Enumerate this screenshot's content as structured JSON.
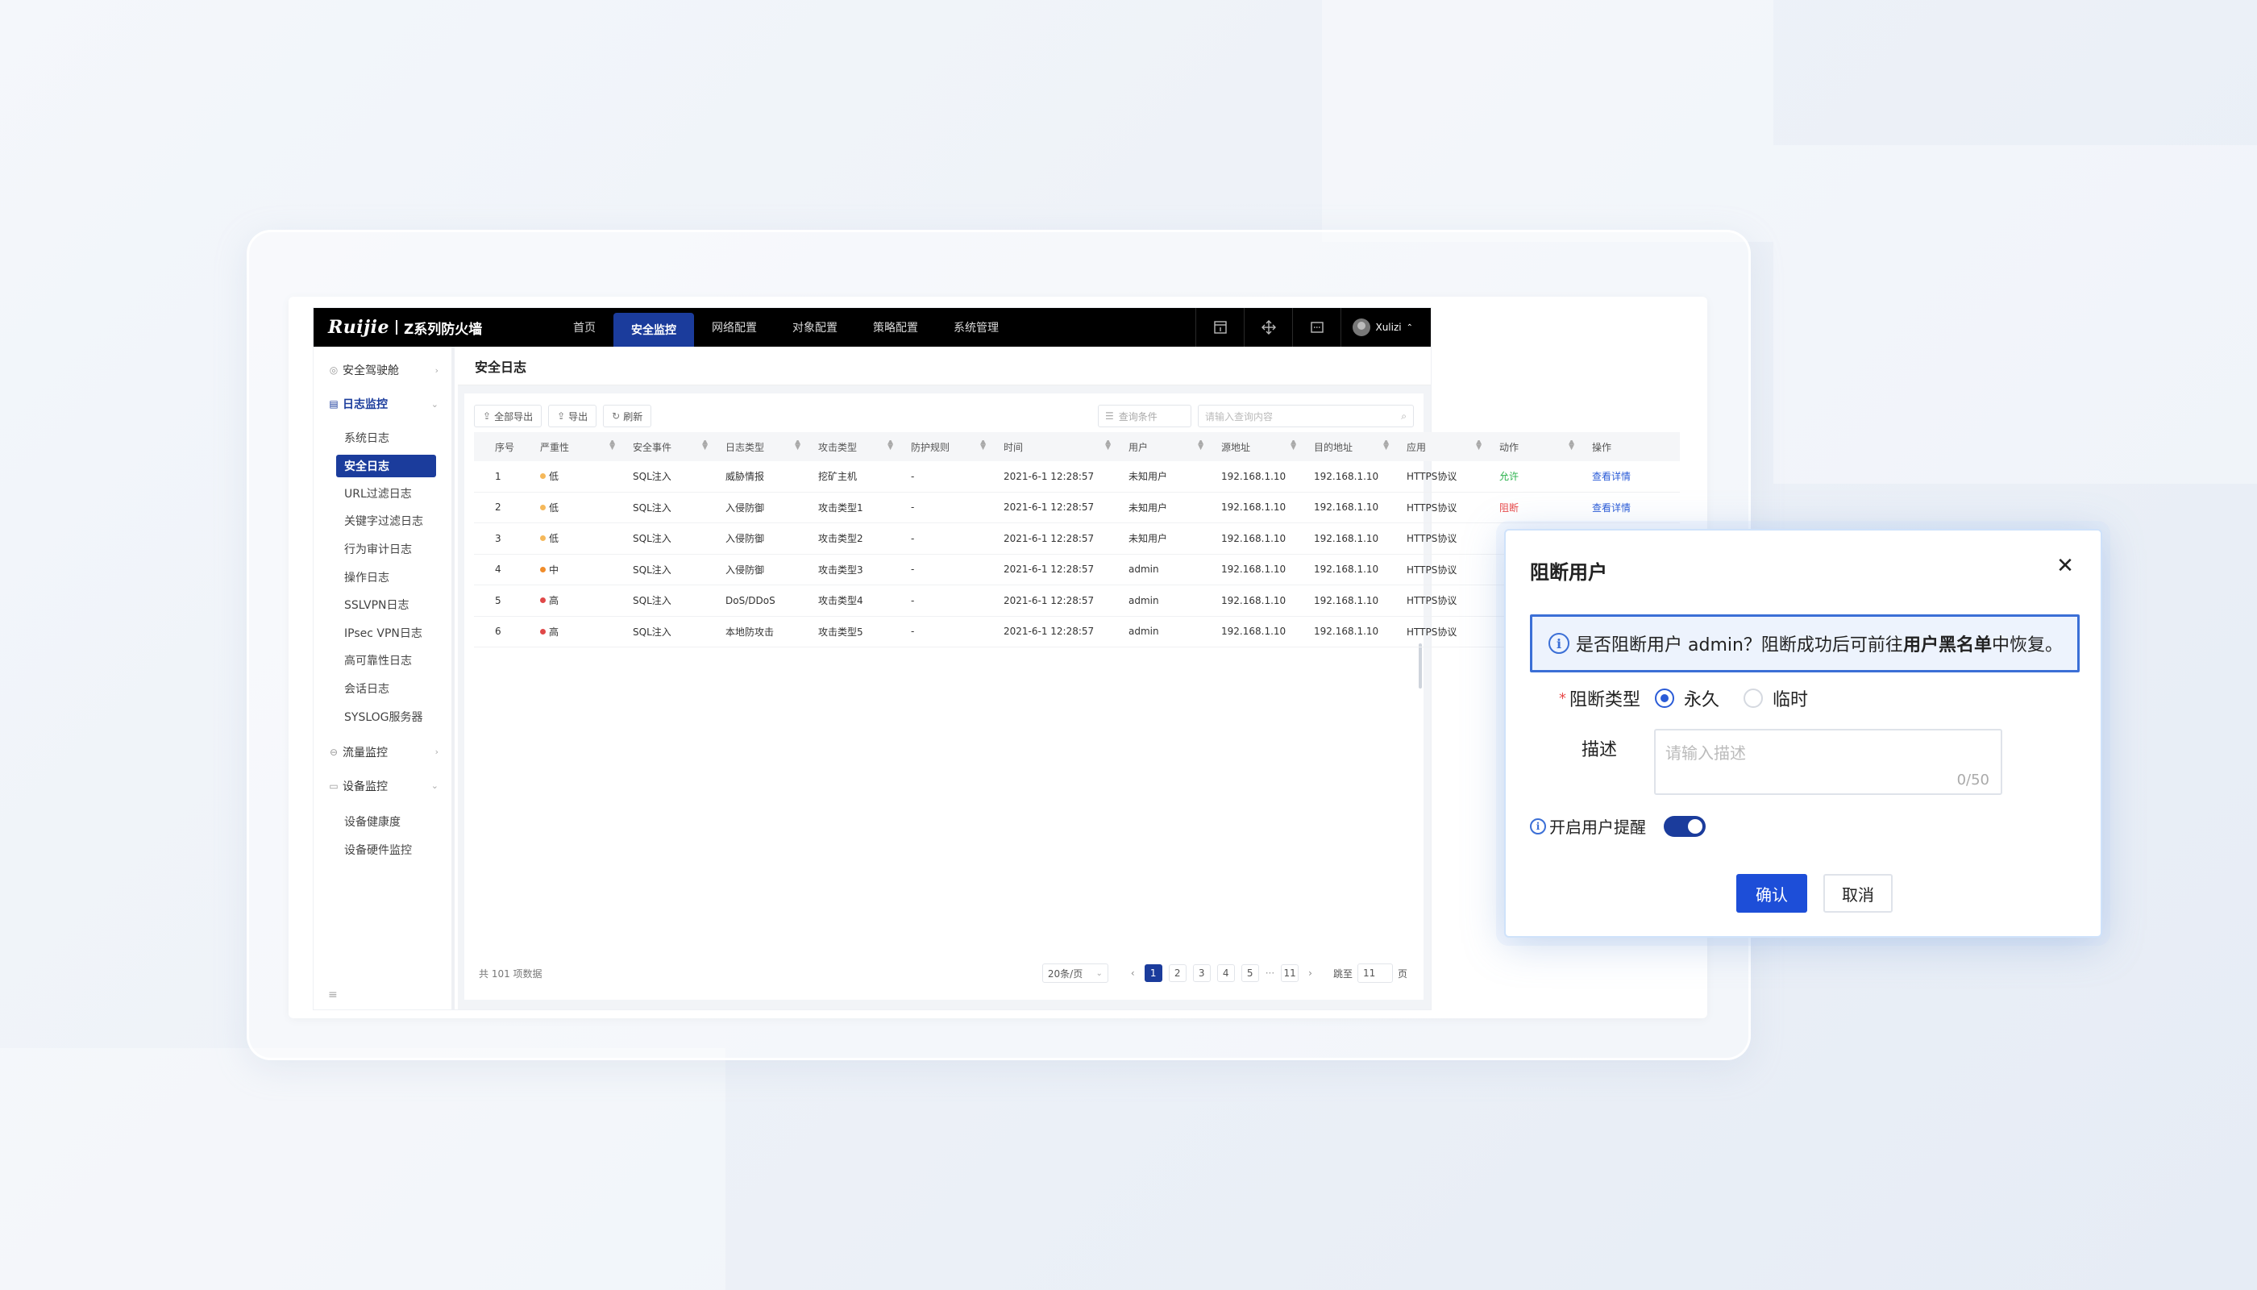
{
  "app": {
    "logo_brand": "Ruijie",
    "logo_product": "Z系列防火墙",
    "nav": [
      {
        "label": "首页"
      },
      {
        "label": "安全监控"
      },
      {
        "label": "网络配置"
      },
      {
        "label": "对象配置"
      },
      {
        "label": "策略配置"
      },
      {
        "label": "系统管理"
      }
    ],
    "nav_active_index": 1,
    "user": "Xulizi"
  },
  "sidebar": {
    "groups": [
      {
        "label": "安全驾驶舱",
        "icon": "dashboard-icon",
        "state": "collapsed"
      },
      {
        "label": "日志监控",
        "icon": "log-icon",
        "state": "expanded"
      },
      {
        "label": "流量监控",
        "icon": "traffic-icon",
        "state": "collapsed"
      },
      {
        "label": "设备监控",
        "icon": "device-icon",
        "state": "expanded"
      }
    ],
    "log_items": [
      "系统日志",
      "安全日志",
      "URL过滤日志",
      "关键字过滤日志",
      "行为审计日志",
      "操作日志",
      "SSLVPN日志",
      "IPsec VPN日志",
      "高可靠性日志",
      "会话日志",
      "SYSLOG服务器"
    ],
    "log_active_index": 1,
    "device_items": [
      "设备健康度",
      "设备硬件监控"
    ]
  },
  "page": {
    "title": "安全日志",
    "toolbar": {
      "export_all": "全部导出",
      "export": "导出",
      "refresh": "刷新",
      "filter_placeholder": "查询条件",
      "search_placeholder": "请输入查询内容"
    }
  },
  "table": {
    "columns": [
      "序号",
      "严重性",
      "安全事件",
      "日志类型",
      "攻击类型",
      "防护规则",
      "时间",
      "用户",
      "源地址",
      "目的地址",
      "应用",
      "动作",
      "操作"
    ],
    "rows": [
      {
        "no": "1",
        "severity": "低",
        "sev_color": "#f5b85a",
        "event": "SQL注入",
        "log_type": "威胁情报",
        "attack": "挖矿主机",
        "rule": "-",
        "time": "2021-6-1 12:28:57",
        "user": "未知用户",
        "src": "192.168.1.10",
        "dst": "192.168.1.10",
        "app": "HTTPS协议",
        "action": "允许",
        "op": "查看详情"
      },
      {
        "no": "2",
        "severity": "低",
        "sev_color": "#f5b85a",
        "event": "SQL注入",
        "log_type": "入侵防御",
        "attack": "攻击类型1",
        "rule": "-",
        "time": "2021-6-1 12:28:57",
        "user": "未知用户",
        "src": "192.168.1.10",
        "dst": "192.168.1.10",
        "app": "HTTPS协议",
        "action": "阻断",
        "op": "查看详情"
      },
      {
        "no": "3",
        "severity": "低",
        "sev_color": "#f5b85a",
        "event": "SQL注入",
        "log_type": "入侵防御",
        "attack": "攻击类型2",
        "rule": "-",
        "time": "2021-6-1 12:28:57",
        "user": "未知用户",
        "src": "192.168.1.10",
        "dst": "192.168.1.10",
        "app": "HTTPS协议",
        "action": "",
        "op": ""
      },
      {
        "no": "4",
        "severity": "中",
        "sev_color": "#f08c2a",
        "event": "SQL注入",
        "log_type": "入侵防御",
        "attack": "攻击类型3",
        "rule": "-",
        "time": "2021-6-1 12:28:57",
        "user": "admin",
        "src": "192.168.1.10",
        "dst": "192.168.1.10",
        "app": "HTTPS协议",
        "action": "",
        "op": ""
      },
      {
        "no": "5",
        "severity": "高",
        "sev_color": "#e04848",
        "event": "SQL注入",
        "log_type": "DoS/DDoS",
        "attack": "攻击类型4",
        "rule": "-",
        "time": "2021-6-1 12:28:57",
        "user": "admin",
        "src": "192.168.1.10",
        "dst": "192.168.1.10",
        "app": "HTTPS协议",
        "action": "",
        "op": ""
      },
      {
        "no": "6",
        "severity": "高",
        "sev_color": "#e04848",
        "event": "SQL注入",
        "log_type": "本地防攻击",
        "attack": "攻击类型5",
        "rule": "-",
        "time": "2021-6-1 12:28:57",
        "user": "admin",
        "src": "192.168.1.10",
        "dst": "192.168.1.10",
        "app": "HTTPS协议",
        "action": "",
        "op": ""
      }
    ]
  },
  "pagination": {
    "total": "共 101 项数据",
    "page_size": "20条/页",
    "pages": [
      "1",
      "2",
      "3",
      "4",
      "5"
    ],
    "ellipsis": "···",
    "last": "11",
    "jump_label": "跳至",
    "jump_value": "11",
    "jump_suffix": "页"
  },
  "dialog": {
    "title": "阻断用户",
    "alert_pre": "是否阻断用户 admin？阻断成功后可前往",
    "alert_bold": "用户黑名单",
    "alert_post": "中恢复。",
    "block_type_label": "阻断类型",
    "option_permanent": "永久",
    "option_temporary": "临时",
    "desc_label": "描述",
    "desc_placeholder": "请输入描述",
    "desc_count": "0/50",
    "remind_label": "开启用户提醒",
    "remind_on": true,
    "confirm": "确认",
    "cancel": "取消"
  }
}
